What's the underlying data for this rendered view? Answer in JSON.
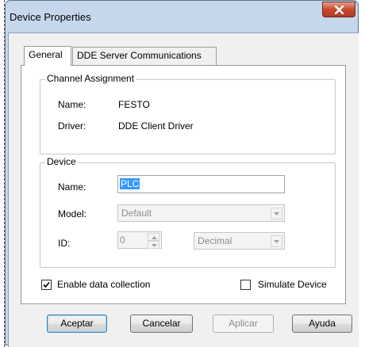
{
  "window": {
    "title": "Device Properties",
    "close_icon": "close-icon"
  },
  "tabs": [
    {
      "label": "General",
      "active": true
    },
    {
      "label": "DDE Server Communications",
      "active": false
    }
  ],
  "channel_assignment": {
    "legend": "Channel Assignment",
    "name_label": "Name:",
    "name_value": "FESTO",
    "driver_label": "Driver:",
    "driver_value": "DDE Client Driver"
  },
  "device": {
    "legend": "Device",
    "name_label": "Name:",
    "name_value": "PLC",
    "model_label": "Model:",
    "model_value": "Default",
    "id_label": "ID:",
    "id_value": "0",
    "id_format_value": "Decimal"
  },
  "options": {
    "enable_data_collection": {
      "label": "Enable data collection",
      "checked": true
    },
    "simulate_device": {
      "label": "Simulate Device",
      "checked": false
    }
  },
  "buttons": {
    "ok": "Aceptar",
    "cancel": "Cancelar",
    "apply": "Aplicar",
    "help": "Ayuda"
  },
  "colors": {
    "selection": "#3399ff",
    "close_button": "#c8472f",
    "frame": "#c6d7ec"
  }
}
